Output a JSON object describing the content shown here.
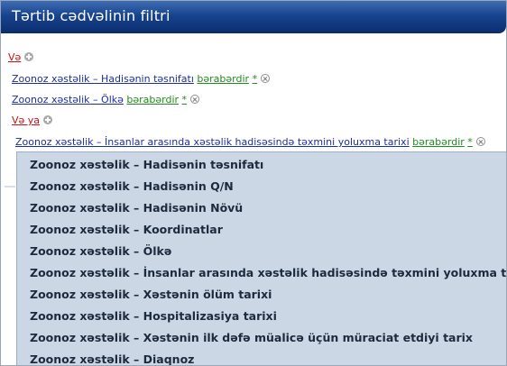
{
  "title": "Tərtib cədvəlinin filtri",
  "filters": {
    "root_operator": "Və",
    "rules": [
      {
        "field": "Zoonoz xəstəlik – Hadisənin təsnifatı",
        "condition": "bərabərdir",
        "value": "*"
      },
      {
        "field": "Zoonoz xəstəlik – Ölkə",
        "condition": "bərabərdir",
        "value": "*"
      }
    ],
    "group_operator": "Və ya",
    "group_rule": {
      "field": "Zoonoz xəstəlik – İnsanlar arasında xəstəlik hadisəsində təxmini yoluxma tarixi",
      "condition": "bərabərdir",
      "value": "*"
    }
  },
  "dropdown": {
    "items": [
      "Zoonoz xəstəlik – Hadisənin təsnifatı",
      "Zoonoz xəstəlik – Hadisənin Q/N",
      "Zoonoz xəstəlik – Hadisənin Növü",
      "Zoonoz xəstəlik – Koordinatlar",
      "Zoonoz xəstəlik – Ölkə",
      "Zoonoz xəstəlik – İnsanlar arasında xəstəlik hadisəsində təxmini yoluxma tarixi",
      "Zoonoz xəstəlik – Xəstənin ölüm tarixi",
      "Zoonoz xəstəlik – Hospitalizasiya tarixi",
      "Zoonoz xəstəlik – Xəstənin ilk dəfə müalicə üçün müraciat etdiyi tarix",
      "Zoonoz xəstəlik – Diaqnoz"
    ]
  },
  "colors": {
    "titlebar": "#17438e",
    "operator": "#cc1111",
    "field": "#1a2fa0",
    "condition": "#1f8a1f",
    "dropdown_bg": "#ccd7e5"
  }
}
